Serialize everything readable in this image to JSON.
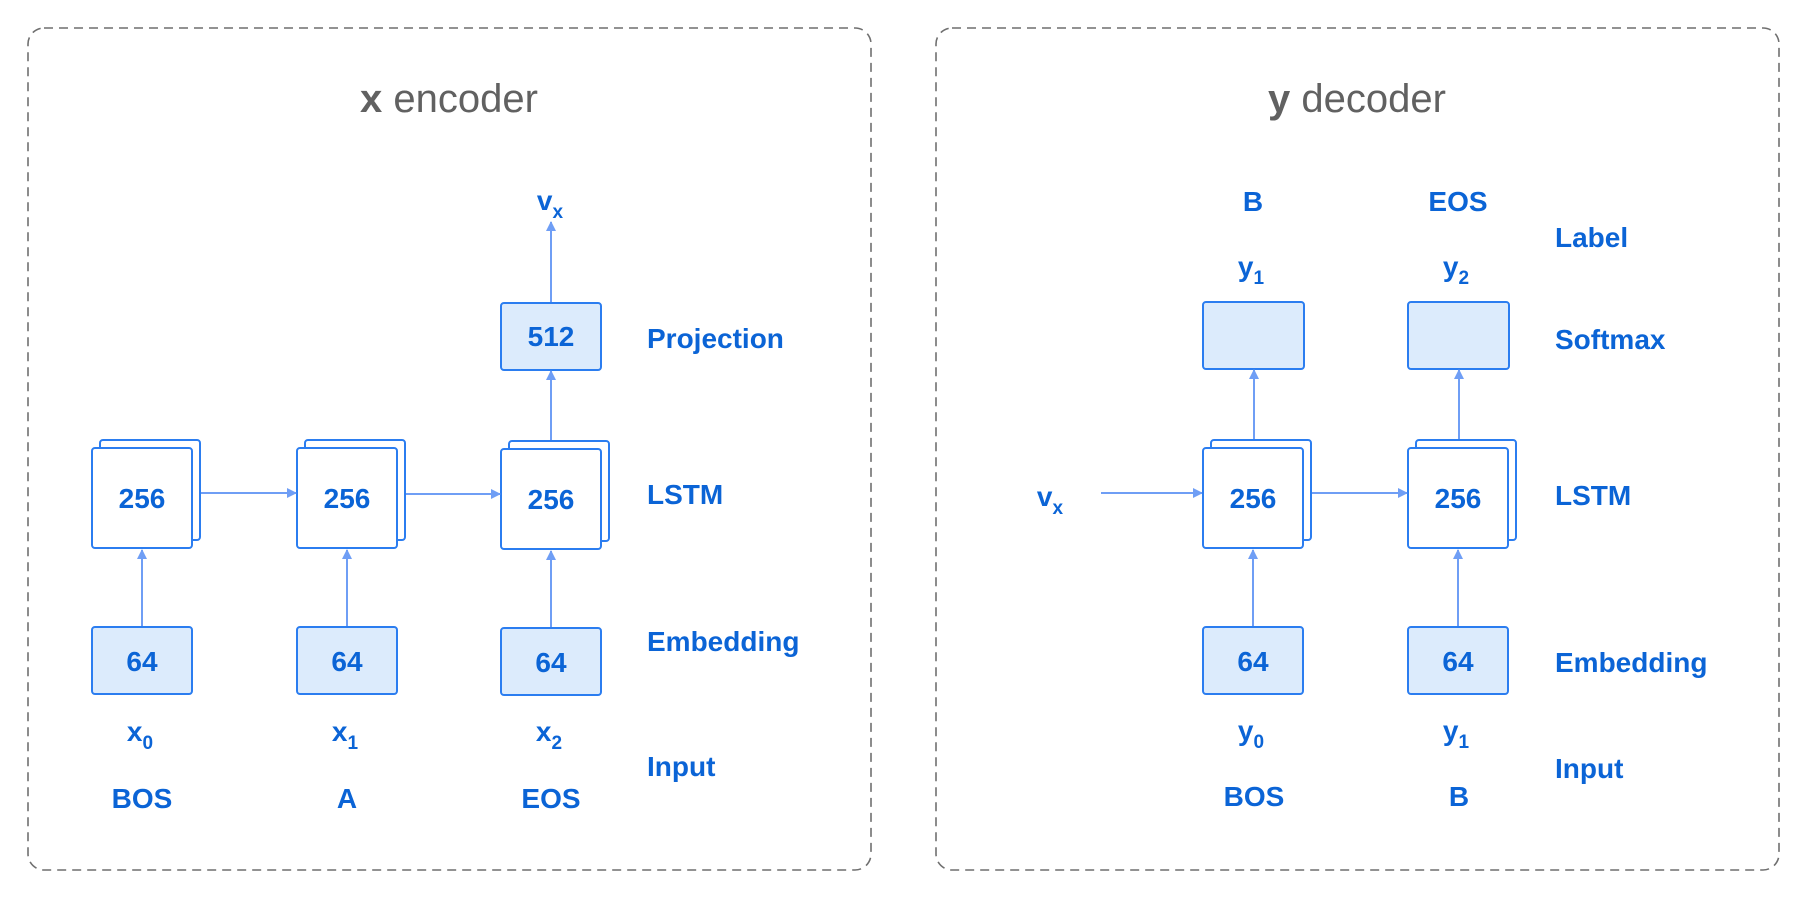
{
  "encoder": {
    "title_bold": "x",
    "title_rest": " encoder",
    "output_label": {
      "main": "v",
      "sub": "x"
    },
    "projection_box": "512",
    "lstm_boxes": [
      "256",
      "256",
      "256"
    ],
    "embedding_boxes": [
      "64",
      "64",
      "64"
    ],
    "inputs": [
      {
        "main": "x",
        "sub": "0",
        "token": "BOS"
      },
      {
        "main": "x",
        "sub": "1",
        "token": "A"
      },
      {
        "main": "x",
        "sub": "2",
        "token": "EOS"
      }
    ],
    "row_labels": {
      "projection": "Projection",
      "lstm": "LSTM",
      "embedding": "Embedding",
      "input": "Input"
    }
  },
  "decoder": {
    "title_bold": "y",
    "title_rest": " decoder",
    "context_label": {
      "main": "v",
      "sub": "x"
    },
    "labels": [
      {
        "token": "B",
        "main": "y",
        "sub": "1"
      },
      {
        "token": "EOS",
        "main": "y",
        "sub": "2"
      }
    ],
    "lstm_boxes": [
      "256",
      "256"
    ],
    "embedding_boxes": [
      "64",
      "64"
    ],
    "inputs": [
      {
        "main": "y",
        "sub": "0",
        "token": "BOS"
      },
      {
        "main": "y",
        "sub": "1",
        "token": "B"
      }
    ],
    "row_labels": {
      "label": "Label",
      "softmax": "Softmax",
      "lstm": "LSTM",
      "embedding": "Embedding",
      "input": "Input"
    }
  },
  "colors": {
    "accent_text": "#0b64d6",
    "box_stroke": "#2b7df0",
    "box_fill": "#dcebfc",
    "arrow": "#6f9ef5",
    "title_gray": "#616161",
    "panel_border": "#6f6f6f"
  }
}
